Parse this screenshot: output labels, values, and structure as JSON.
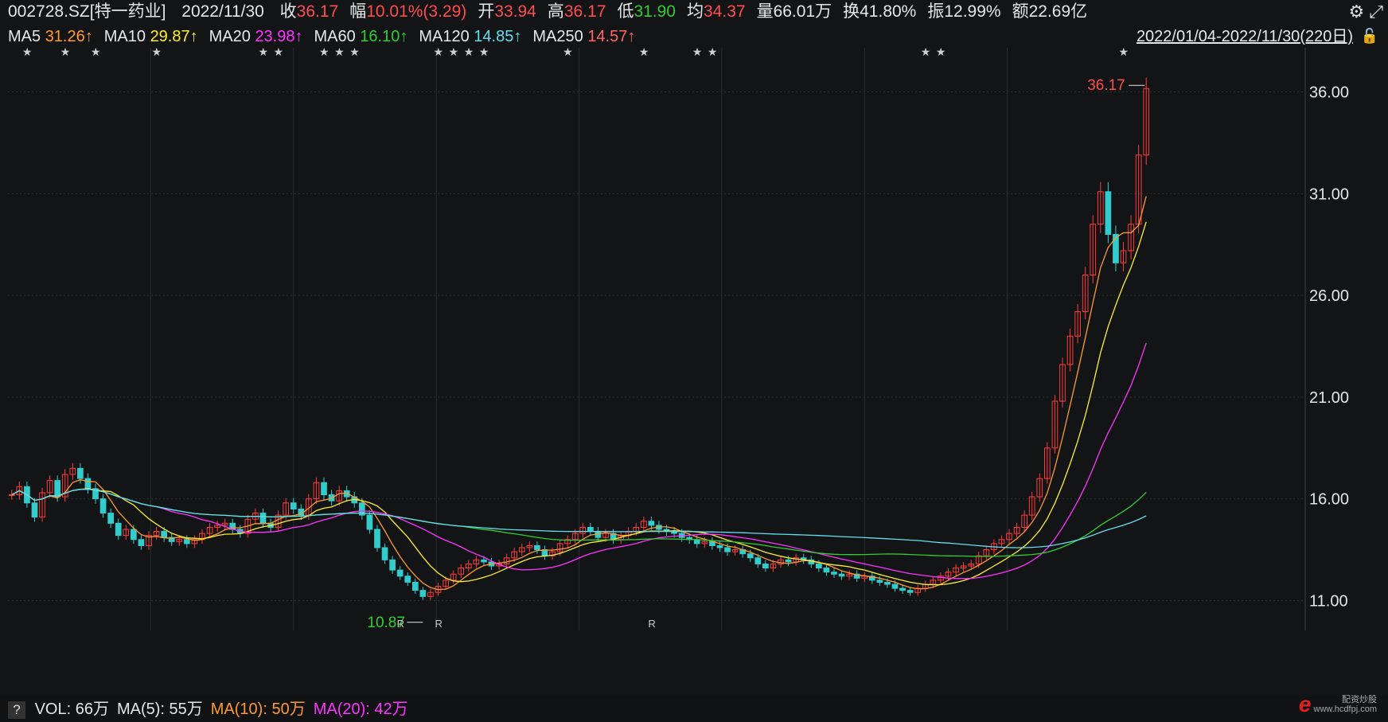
{
  "quote": {
    "code_name": "002728.SZ[特一药业]",
    "date": "2022/11/30",
    "items": [
      {
        "label": "收",
        "value": "36.17",
        "color": "#ff4d4d"
      },
      {
        "label": "幅",
        "value": "10.01%(3.29)",
        "color": "#ff4d4d"
      },
      {
        "label": "开",
        "value": "33.94",
        "color": "#ff4d4d"
      },
      {
        "label": "高",
        "value": "36.17",
        "color": "#ff4d4d"
      },
      {
        "label": "低",
        "value": "31.90",
        "color": "#33cc33"
      },
      {
        "label": "均",
        "value": "34.37",
        "color": "#ff4d4d"
      },
      {
        "label": "量",
        "value": "66.01万",
        "color": "#e6e6e6"
      },
      {
        "label": "换",
        "value": "41.80%",
        "color": "#e6e6e6"
      },
      {
        "label": "振",
        "value": "12.99%",
        "color": "#e6e6e6"
      },
      {
        "label": "额",
        "value": "22.69亿",
        "color": "#e6e6e6"
      }
    ]
  },
  "ma_legend": [
    {
      "label": "MA5",
      "value": "31.26↑",
      "color": "#ff9933"
    },
    {
      "label": "MA10",
      "value": "29.87↑",
      "color": "#ffee33"
    },
    {
      "label": "MA20",
      "value": "23.98↑",
      "color": "#ff33ff"
    },
    {
      "label": "MA60",
      "value": "16.10↑",
      "color": "#33cc33"
    },
    {
      "label": "MA120",
      "value": "14.85↑",
      "color": "#66ddee"
    },
    {
      "label": "MA250",
      "value": "14.57↑",
      "color": "#ff6666"
    }
  ],
  "date_range": "2022/01/04-2022/11/30(220日)",
  "icons": {
    "settings": "gear-icon",
    "expand": "expand-icon",
    "lock": "lock-icon"
  },
  "volume_bar": {
    "help": "?",
    "items": [
      {
        "text": "VOL: 66万",
        "color": "#e6e6e6"
      },
      {
        "text": "MA(5): 55万",
        "color": "#e6e6e6"
      },
      {
        "text": "MA(10): 50万",
        "color": "#ff9933"
      },
      {
        "text": "MA(20): 42万",
        "color": "#ff33ff"
      }
    ]
  },
  "watermark": {
    "brand": "e",
    "line1": "配资炒股",
    "line2": "www.hcdfpj.com"
  },
  "chart_data": {
    "type": "candlestick",
    "ylim": [
      10,
      37
    ],
    "y_ticks": [
      "36.00",
      "31.00",
      "26.00",
      "21.00",
      "16.00",
      "11.00"
    ],
    "y_tick_values": [
      36,
      31,
      26,
      21,
      16,
      11
    ],
    "high_label": "36.17",
    "low_label": "10.87",
    "high_value": 36.17,
    "low_value": 10.87,
    "r_markers": [
      "R",
      "R",
      "R"
    ],
    "r_marker_index": [
      51,
      56,
      84
    ],
    "colors": {
      "up": "#ff3b3b",
      "down": "#33cccc",
      "grid": "#2a2f33"
    },
    "close": [
      16.2,
      16.6,
      15.8,
      15.1,
      16.3,
      16.9,
      16.1,
      17.2,
      17.5,
      17.0,
      16.5,
      16.0,
      15.3,
      14.8,
      14.2,
      14.5,
      14.0,
      13.7,
      14.2,
      14.4,
      14.1,
      13.9,
      14.0,
      13.8,
      14.0,
      14.3,
      14.6,
      14.7,
      14.8,
      14.5,
      14.3,
      15.0,
      15.3,
      14.8,
      14.6,
      15.2,
      15.8,
      15.5,
      15.2,
      16.0,
      16.8,
      16.2,
      15.9,
      16.4,
      16.1,
      15.8,
      15.2,
      14.5,
      13.6,
      13.0,
      12.5,
      12.2,
      11.9,
      11.5,
      11.2,
      11.4,
      11.7,
      12.0,
      12.3,
      12.6,
      12.8,
      13.0,
      12.9,
      12.7,
      12.8,
      13.1,
      13.4,
      13.6,
      13.7,
      13.5,
      13.2,
      13.4,
      13.8,
      14.0,
      14.3,
      14.6,
      14.4,
      14.1,
      14.3,
      14.0,
      14.2,
      14.4,
      14.6,
      14.9,
      14.7,
      14.5,
      14.4,
      14.3,
      14.1,
      14.0,
      13.8,
      13.9,
      13.7,
      13.6,
      13.4,
      13.5,
      13.3,
      13.1,
      12.8,
      12.6,
      12.8,
      13.0,
      12.9,
      13.1,
      13.0,
      12.8,
      12.6,
      12.4,
      12.3,
      12.2,
      12.3,
      12.1,
      12.2,
      12.0,
      11.9,
      11.8,
      11.6,
      11.5,
      11.4,
      11.6,
      11.8,
      12.0,
      12.2,
      12.4,
      12.6,
      12.7,
      12.8,
      13.2,
      13.5,
      13.8,
      14.0,
      14.3,
      14.6,
      15.2,
      16.1,
      17.0,
      18.5,
      20.8,
      22.6,
      24.0,
      25.2,
      27.0,
      29.5,
      31.1,
      29.0,
      27.6,
      28.2,
      29.5,
      32.9,
      36.17
    ],
    "ma_series": [
      {
        "name": "MA5",
        "color": "#ff9933",
        "window": 5
      },
      {
        "name": "MA10",
        "color": "#ffee33",
        "window": 10
      },
      {
        "name": "MA20",
        "color": "#ff33ff",
        "window": 20
      },
      {
        "name": "MA60",
        "color": "#33cc33",
        "window": 60
      },
      {
        "name": "MA120",
        "color": "#66ddee",
        "window": 120
      }
    ]
  }
}
